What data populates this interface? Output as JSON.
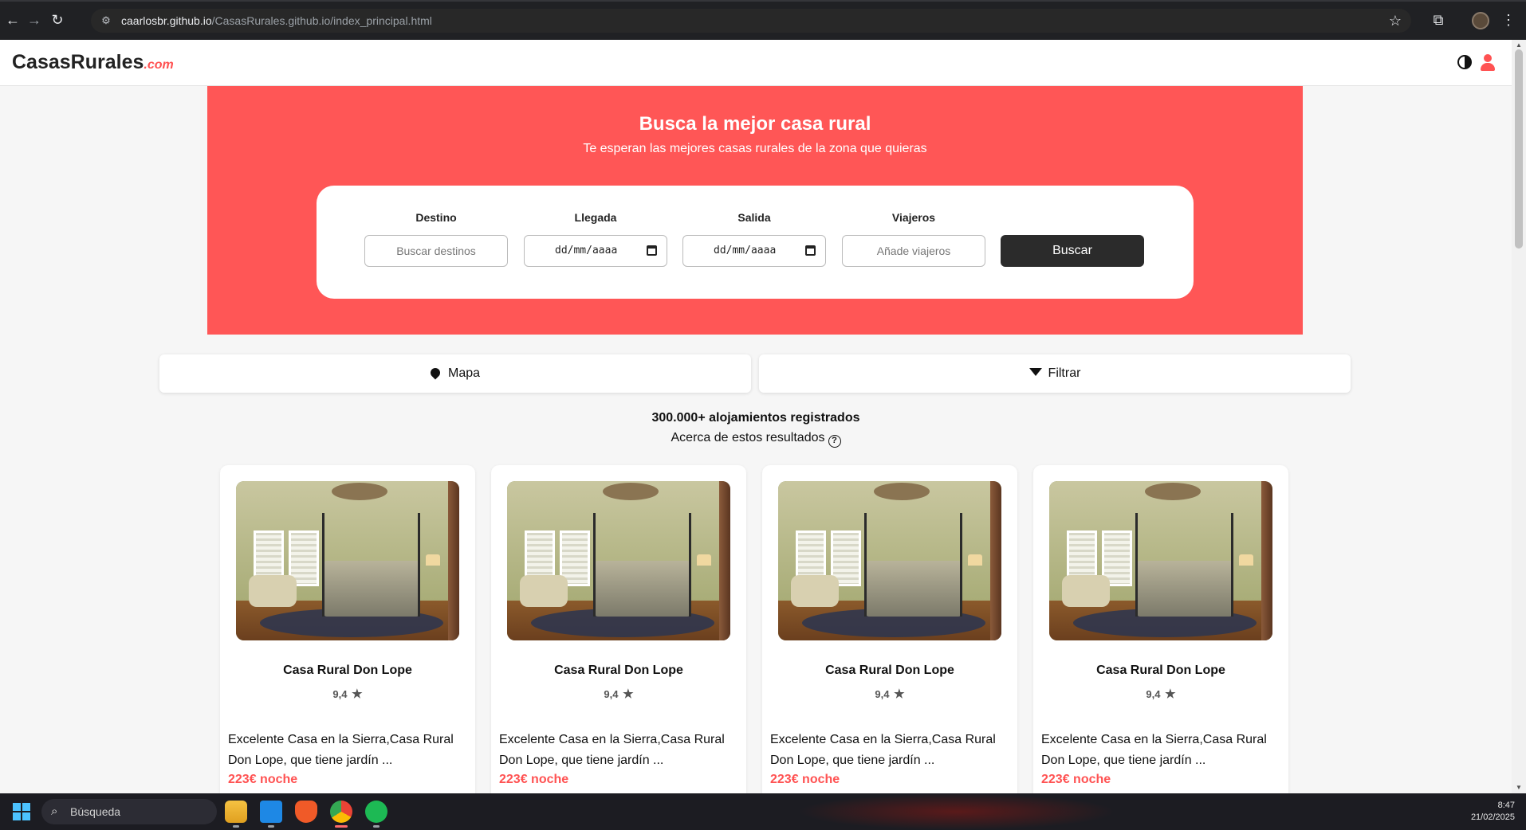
{
  "browser": {
    "url_host": "caarlosbr.github.io",
    "url_path": "/CasasRurales.github.io/index_principal.html",
    "back_icon": "arrow-left-icon",
    "forward_icon": "arrow-right-icon",
    "reload_icon": "reload-icon",
    "bookmark_icon": "star-icon",
    "extensions_icon": "puzzle-icon",
    "menu_icon": "kebab-menu-icon"
  },
  "header": {
    "logo_main": "CasasRurales",
    "logo_suffix": ".com",
    "theme_icon": "contrast-icon",
    "user_icon": "user-icon"
  },
  "hero": {
    "title": "Busca la mejor casa rural",
    "subtitle": "Te esperan las mejores casas rurales de la zona que quieras"
  },
  "search": {
    "destination_label": "Destino",
    "destination_placeholder": "Buscar destinos",
    "arrival_label": "Llegada",
    "arrival_value": "dd/mm/aaaa",
    "departure_label": "Salida",
    "departure_value": "dd/mm/aaaa",
    "travelers_label": "Viajeros",
    "travelers_placeholder": "Añade viajeros",
    "button_label": "Buscar"
  },
  "tools": {
    "map_label": "Mapa",
    "map_icon": "map-pin-icon",
    "filter_label": "Filtrar",
    "filter_icon": "filter-icon"
  },
  "results": {
    "count_text": "300.000+ alojamientos registrados",
    "about_text": "Acerca de estos resultados",
    "about_icon": "help-circle-icon"
  },
  "cards": [
    {
      "title": "Casa Rural Don Lope",
      "rating": "9,4",
      "desc": "Excelente Casa en la Sierra,Casa Rural Don Lope, que tiene jardín ...",
      "price": "223€ noche"
    },
    {
      "title": "Casa Rural Don Lope",
      "rating": "9,4",
      "desc": "Excelente Casa en la Sierra,Casa Rural Don Lope, que tiene jardín ...",
      "price": "223€ noche"
    },
    {
      "title": "Casa Rural Don Lope",
      "rating": "9,4",
      "desc": "Excelente Casa en la Sierra,Casa Rural Don Lope, que tiene jardín ...",
      "price": "223€ noche"
    },
    {
      "title": "Casa Rural Don Lope",
      "rating": "9,4",
      "desc": "Excelente Casa en la Sierra,Casa Rural Don Lope, que tiene jardín ...",
      "price": "223€ noche"
    }
  ],
  "colors": {
    "brand": "#ff5656",
    "button_dark": "#2b2b2b",
    "price": "#ff5252"
  },
  "taskbar": {
    "search_placeholder": "Búsqueda",
    "time": "8:47",
    "date": "21/02/2025",
    "apps": [
      "file-explorer-icon",
      "vscode-icon",
      "brave-icon",
      "chrome-icon",
      "spotify-icon"
    ]
  }
}
